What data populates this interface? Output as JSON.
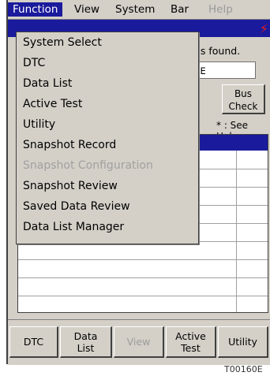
{
  "menubar": [
    {
      "label": "Function",
      "state": "active"
    },
    {
      "label": "View",
      "state": "normal"
    },
    {
      "label": "System",
      "state": "normal"
    },
    {
      "label": "Bar",
      "state": "normal"
    },
    {
      "label": "Help",
      "state": "disabled"
    }
  ],
  "function_menu": [
    {
      "label": "System Select",
      "enabled": true
    },
    {
      "label": "DTC",
      "enabled": true
    },
    {
      "label": "Data List",
      "enabled": true
    },
    {
      "label": "Active Test",
      "enabled": true
    },
    {
      "label": "Utility",
      "enabled": true
    },
    {
      "label": "Snapshot Record",
      "enabled": true
    },
    {
      "label": "Snapshot Configuration",
      "enabled": false
    },
    {
      "label": "Snapshot Review",
      "enabled": true
    },
    {
      "label": "Saved Data Review",
      "enabled": true
    },
    {
      "label": "Data List Manager",
      "enabled": true
    }
  ],
  "main": {
    "message": "was found.",
    "vin_value": "ZFE",
    "bus_check_line1": "Bus",
    "bus_check_line2": "Check",
    "see_help": "* : See Help"
  },
  "toolbar": [
    {
      "line1": "DTC",
      "line2": "",
      "enabled": true
    },
    {
      "line1": "Data",
      "line2": "List",
      "enabled": true
    },
    {
      "line1": "View",
      "line2": "",
      "enabled": false
    },
    {
      "line1": "Active",
      "line2": "Test",
      "enabled": true
    },
    {
      "line1": "Utility",
      "line2": "",
      "enabled": true
    }
  ],
  "figure_code": "T00160E",
  "colors": {
    "menu_highlight": "#1a1a9c",
    "window_bg": "#d4d0c8",
    "alert": "#e02020"
  }
}
